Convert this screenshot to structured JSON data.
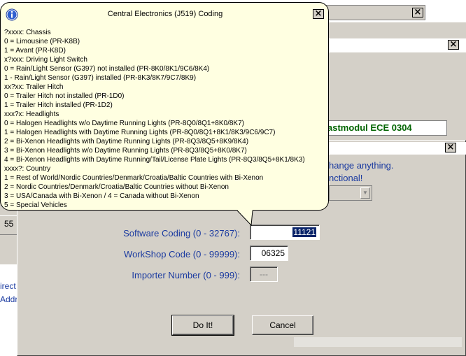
{
  "modul_text": "astmodul  ECE 0304",
  "left_panel": {
    "number": "55",
    "link1": "irect",
    "link2": "Addr"
  },
  "dialog": {
    "line1": "hange anything.",
    "line2": "nctional!"
  },
  "coding_form": {
    "software_coding_label": "Software Coding (0 - 32767):",
    "software_coding_value": "11121",
    "workshop_code_label": "WorkShop Code (0 - 99999):",
    "workshop_code_value": "06325",
    "importer_number_label": "Importer Number (0 - 999):",
    "importer_number_value": "---",
    "do_it_label": "Do It!",
    "cancel_label": "Cancel"
  },
  "tooltip": {
    "title": "Central Electronics (J519) Coding",
    "lines": [
      "?xxxx: Chassis",
      "0 = Limousine (PR-K8B)",
      "1 = Avant (PR-K8D)",
      "x?xxx: Driving Light Switch",
      "0 = Rain/Light Sensor (G397) not installed (PR-8K0/8K1/9C6/8K4)",
      "1 - Rain/Light Sensor (G397) installed (PR-8K3/8K7/9C7/8K9)",
      "xx?xx: Trailer Hitch",
      "0 = Trailer Hitch not installed (PR-1D0)",
      "1 = Trailer Hitch installed (PR-1D2)",
      "xxx?x: Headlights",
      "0 = Halogen Headlights w/o Daytime Running Lights (PR-8Q0/8Q1+8K0/8K7)",
      "1 = Halogen Headlights with Daytime Running Lights (PR-8Q0/8Q1+8K1/8K3/9C6/9C7)",
      "2 = Bi-Xenon Headlights with Daytime Running Lights (PR-8Q3/8Q5+8K9/8K4)",
      "3 = Bi-Xenon Headlights w/o Daytime Running Lights (PR-8Q3/8Q5+8K0/8K7)",
      "4 = Bi-Xenon Headlights with Daytime Running/Tail/License Plate Lights (PR-8Q3/8Q5+8K1/8K3)",
      "xxxx?: Country",
      "1 = Rest of World/Nordic Countries/Denmark/Croatia/Baltic Countries with Bi-Xenon",
      "2 = Nordic Countries/Denmark/Croatia/Baltic Countries without Bi-Xenon",
      "3 = USA/Canada with Bi-Xenon / 4 = Canada without Bi-Xenon",
      "5 = Special Vehicles"
    ]
  }
}
